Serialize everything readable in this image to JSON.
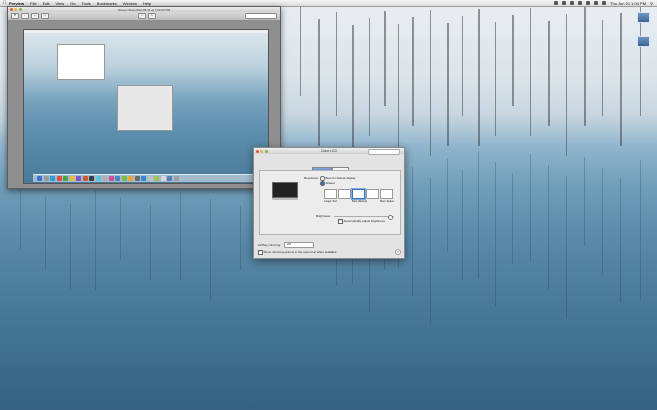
{
  "menubar": {
    "app": "Preview",
    "items": [
      "File",
      "Edit",
      "View",
      "Go",
      "Tools",
      "Bookmarks",
      "Window",
      "Help"
    ],
    "datetime": "Thu Jun 21  1:04 PM"
  },
  "preview_window": {
    "title": "Screen Shot 2012-06-21 at 1:03:29 PM"
  },
  "displays_prefs": {
    "title": "Color LCD",
    "tabs": [
      "Display",
      "Color"
    ],
    "resolution_label": "Resolution:",
    "best_option": "Best for Retina display",
    "scaled_option": "Scaled",
    "options": [
      "Larger Text",
      "",
      "Best (Retina)",
      "",
      "More Space"
    ],
    "brightness_label": "Brightness:",
    "auto_brightness": "Automatically adjust brightness",
    "airplay_label": "AirPlay mirroring:",
    "airplay_value": "Off",
    "show_mirroring": "Show mirroring options in the menu bar when available"
  },
  "colors": {
    "accent": "#3b6fc0"
  }
}
